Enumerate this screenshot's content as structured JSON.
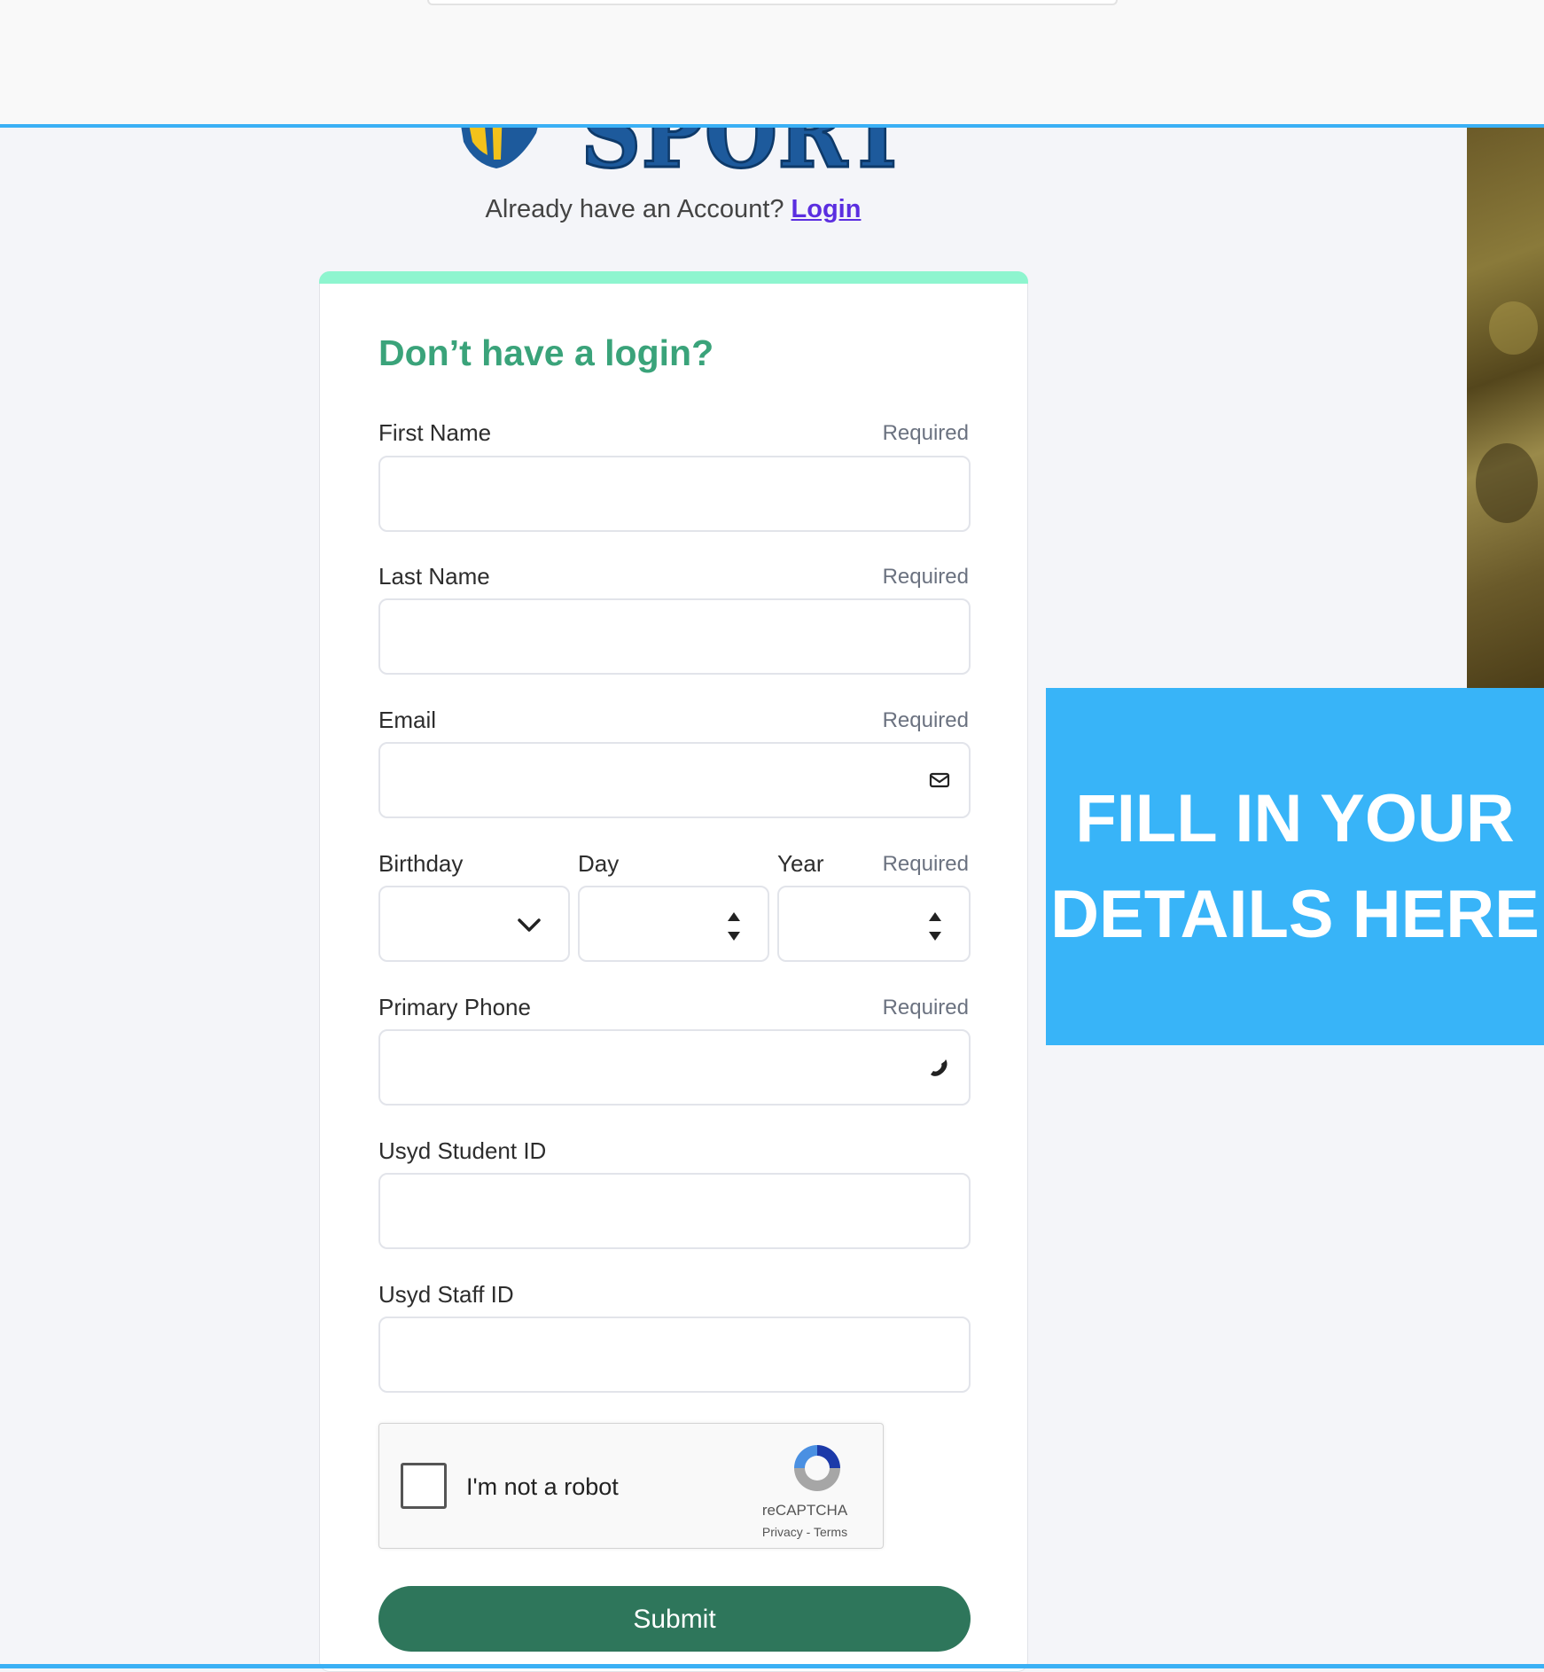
{
  "header": {
    "search_bar": ""
  },
  "logo": {
    "text": "SPORT",
    "icon": "shield-logo-icon"
  },
  "account_prompt": {
    "text": "Already have an Account?",
    "login_link": "Login"
  },
  "banner": {
    "line1": "FILL IN YOUR",
    "line2": "DETAILS HERE"
  },
  "form": {
    "title": "Don’t have a login?",
    "first_name": {
      "label": "First Name",
      "required": "Required",
      "value": ""
    },
    "last_name": {
      "label": "Last Name",
      "required": "Required",
      "value": ""
    },
    "email": {
      "label": "Email",
      "required": "Required",
      "value": "",
      "icon": "envelope-icon"
    },
    "birthday": {
      "label": "Birthday",
      "day_label": "Day",
      "year_label": "Year",
      "required": "Required",
      "month_value": "",
      "day_value": "",
      "year_value": ""
    },
    "primary_phone": {
      "label": "Primary Phone",
      "required": "Required",
      "value": "",
      "icon": "phone-icon"
    },
    "student_id": {
      "label": "Usyd Student ID",
      "value": ""
    },
    "staff_id": {
      "label": "Usyd Staff ID",
      "value": ""
    },
    "captcha": {
      "text": "I'm not a robot",
      "brand": "reCAPTCHA",
      "links": "Privacy - Terms"
    },
    "submit_label": "Submit"
  },
  "colors": {
    "accent_blue": "#38b4f8",
    "title_green": "#3aa37a",
    "submit_green": "#2e765b",
    "card_accent": "#8ef5cf",
    "link_purple": "#5b2ee0"
  }
}
